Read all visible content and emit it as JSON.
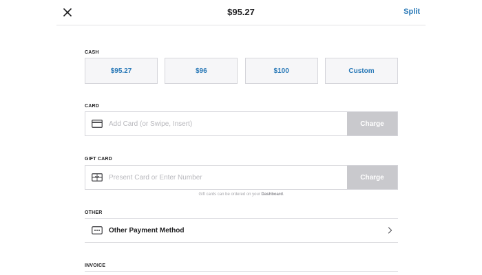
{
  "header": {
    "title": "$95.27",
    "split_label": "Split",
    "close_icon": "close-icon"
  },
  "cash": {
    "label": "CASH",
    "options": [
      "$95.27",
      "$96",
      "$100",
      "Custom"
    ]
  },
  "card": {
    "label": "CARD",
    "placeholder": "Add Card (or Swipe, Insert)",
    "value": "",
    "charge_label": "Charge",
    "icon": "credit-card-icon"
  },
  "gift_card": {
    "label": "GIFT CARD",
    "placeholder": "Present Card or Enter Number",
    "value": "",
    "charge_label": "Charge",
    "icon": "gift-card-icon",
    "note_prefix": "Gift cards can be ordered on your",
    "note_link": "Dashboard",
    "note_suffix": "."
  },
  "other": {
    "label": "OTHER",
    "item_label": "Other Payment Method",
    "icon": "more-dots-icon",
    "chevron": "chevron-right-icon"
  },
  "invoice": {
    "label": "INVOICE"
  },
  "colors": {
    "accent": "#2b7ab8",
    "charge_disabled": "#c9c9cd",
    "tile_bg": "#f6f6f8",
    "border": "#d5d5da"
  }
}
